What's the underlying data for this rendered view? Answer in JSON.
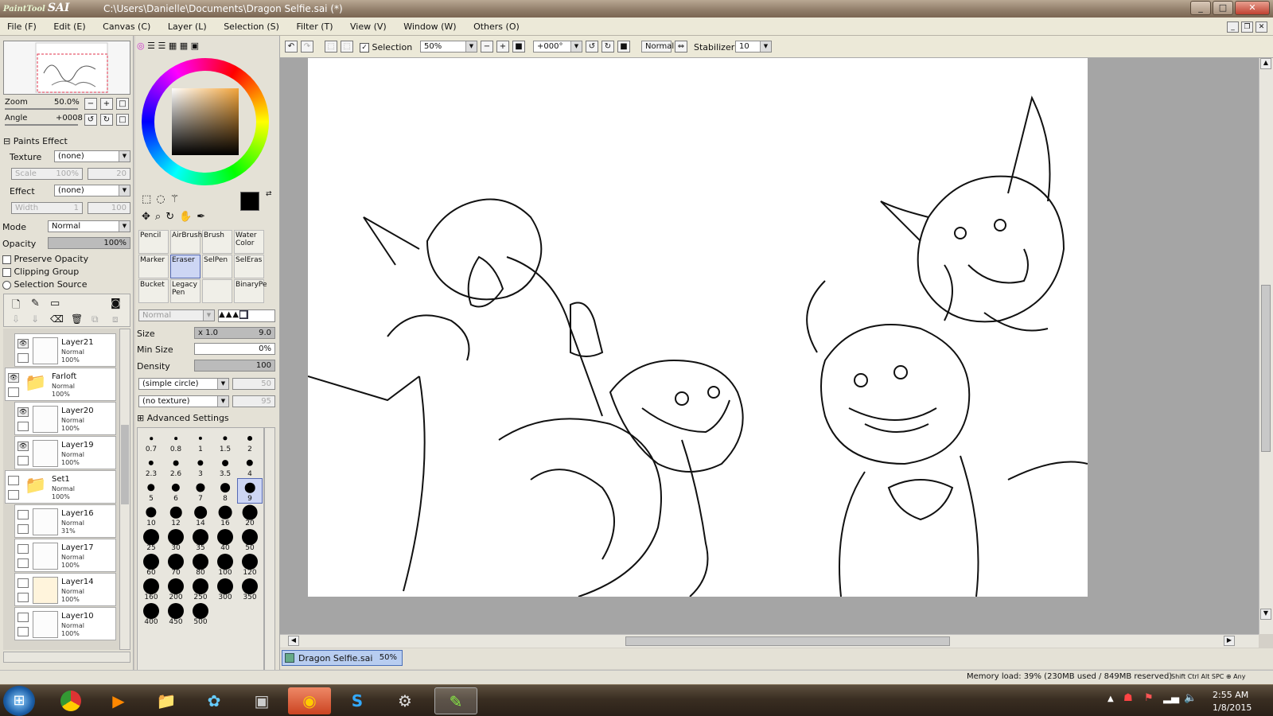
{
  "titlebar": {
    "logo_small": "PaintTool",
    "logo": "SAI",
    "title": "C:\\Users\\Danielle\\Documents\\Dragon Selfie.sai (*)",
    "minimize": "_",
    "maximize": "□",
    "close": "✕"
  },
  "menu": [
    "File (F)",
    "Edit (E)",
    "Canvas (C)",
    "Layer (L)",
    "Selection (S)",
    "Filter (T)",
    "View (V)",
    "Window (W)",
    "Others (O)"
  ],
  "navigator": {
    "zoom_label": "Zoom",
    "zoom_value": "50.0%",
    "angle_label": "Angle",
    "angle_value": "+0008"
  },
  "paints_effect": {
    "header": "Paints Effect",
    "texture_label": "Texture",
    "texture_value": "(none)",
    "scale_label": "Scale",
    "scale_value": "100%",
    "scale_num": "20",
    "effect_label": "Effect",
    "effect_value": "(none)",
    "width_label": "Width",
    "width_value": "1",
    "width_num": "100"
  },
  "layer_props": {
    "mode_label": "Mode",
    "mode_value": "Normal",
    "opacity_label": "Opacity",
    "opacity_value": "100%",
    "preserve_opacity": "Preserve Opacity",
    "clipping_group": "Clipping Group",
    "selection_source": "Selection Source"
  },
  "layers": [
    {
      "name": "Layer21",
      "mode": "Normal",
      "opacity": "100%",
      "visible": true,
      "folder": false
    },
    {
      "name": "Farloft",
      "mode": "Normal",
      "opacity": "100%",
      "visible": true,
      "folder": true
    },
    {
      "name": "Layer20",
      "mode": "Normal",
      "opacity": "100%",
      "visible": true,
      "folder": false
    },
    {
      "name": "Layer19",
      "mode": "Normal",
      "opacity": "100%",
      "visible": true,
      "folder": false
    },
    {
      "name": "Set1",
      "mode": "Normal",
      "opacity": "100%",
      "visible": false,
      "folder": true
    },
    {
      "name": "Layer16",
      "mode": "Normal",
      "opacity": "31%",
      "visible": false,
      "folder": false
    },
    {
      "name": "Layer17",
      "mode": "Normal",
      "opacity": "100%",
      "visible": false,
      "folder": false
    },
    {
      "name": "Layer14",
      "mode": "Normal",
      "opacity": "100%",
      "visible": false,
      "folder": false
    },
    {
      "name": "Layer10",
      "mode": "Normal",
      "opacity": "100%",
      "visible": false,
      "folder": false
    }
  ],
  "tools": [
    {
      "label": "Pencil",
      "selected": false
    },
    {
      "label": "AirBrush",
      "selected": false
    },
    {
      "label": "Brush",
      "selected": false
    },
    {
      "label": "Water Color",
      "selected": false
    },
    {
      "label": "Marker",
      "selected": false
    },
    {
      "label": "Eraser",
      "selected": true
    },
    {
      "label": "SelPen",
      "selected": false
    },
    {
      "label": "SelEras",
      "selected": false
    },
    {
      "label": "Bucket",
      "selected": false
    },
    {
      "label": "Legacy Pen",
      "selected": false
    },
    {
      "label": "",
      "selected": false
    },
    {
      "label": "BinaryPe",
      "selected": false
    }
  ],
  "tool_settings": {
    "blend_mode": "Normal",
    "size_label": "Size",
    "size_mult": "x 1.0",
    "size_value": "9.0",
    "min_size_label": "Min Size",
    "min_size_value": "0%",
    "density_label": "Density",
    "density_value": "100",
    "shape": "(simple circle)",
    "shape_num": "50",
    "texture": "(no texture)",
    "texture_num": "95",
    "advanced": "Advanced Settings"
  },
  "brush_sizes": [
    "0.7",
    "0.8",
    "1",
    "1.5",
    "2",
    "2.3",
    "2.6",
    "3",
    "3.5",
    "4",
    "5",
    "6",
    "7",
    "8",
    "9",
    "10",
    "12",
    "14",
    "16",
    "20",
    "25",
    "30",
    "35",
    "40",
    "50",
    "60",
    "70",
    "80",
    "100",
    "120",
    "160",
    "200",
    "250",
    "300",
    "350",
    "400",
    "450",
    "500"
  ],
  "selected_brush_size": "9",
  "toolbar": {
    "selection_label": "Selection",
    "selection_checked": true,
    "zoom": "50%",
    "angle": "+000°",
    "mode": "Normal",
    "stabilizer_label": "Stabilizer",
    "stabilizer_value": "10"
  },
  "document_tab": {
    "name": "Dragon Selfie.sai",
    "zoom": "50%"
  },
  "status": {
    "memory": "Memory load: 39% (230MB used / 849MB reserved)",
    "keys": "Shift Ctrl Alt SPC ⊕ Any"
  },
  "taskbar": {
    "time": "2:55 AM",
    "date": "1/8/2015",
    "apps": [
      "start-orb",
      "chrome",
      "media-player",
      "file-explorer",
      "network-app",
      "computer",
      "firefox",
      "skype",
      "steam",
      "painttool-sai"
    ]
  },
  "colors": {
    "accent_selection": "#cdd6f4",
    "current_color": "#000000",
    "canvas_bg": "#a5a5a5"
  }
}
